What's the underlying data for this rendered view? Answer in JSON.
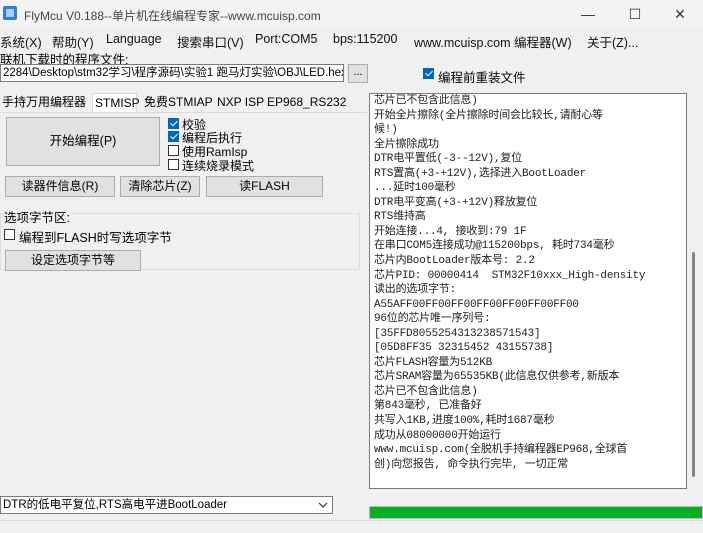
{
  "window": {
    "title": "FlyMcu V0.188--单片机在线编程专家--www.mcuisp.com",
    "minimize": "—",
    "maximize": "☐",
    "close": "✕"
  },
  "menu": [
    "系统(X)",
    "帮助(Y)",
    "Language",
    "搜索串口(V)",
    "Port:COM5",
    "bps:115200",
    "www.mcuisp.com 编程器(W)",
    "关于(Z)..."
  ],
  "file": {
    "label": "联机下载时的程序文件:",
    "path": "2284\\Desktop\\stm32学习\\程序源码\\实验1 跑马灯实验\\OBJ\\LED.hex",
    "browse": "...",
    "reload_label": "编程前重装文件",
    "reload_checked": true
  },
  "tabs": [
    "手持万用编程器",
    "STMISP",
    "免费STMIAP",
    "NXP ISP",
    "EP968_RS232"
  ],
  "active_tab": "STMISP",
  "stmisp": {
    "start_button": "开始编程(P)",
    "options": [
      {
        "label": "校验",
        "checked": true
      },
      {
        "label": "编程后执行",
        "checked": true
      },
      {
        "label": "使用RamIsp",
        "checked": false
      },
      {
        "label": "连续烧录模式",
        "checked": false
      }
    ],
    "read_info_button": "读器件信息(R)",
    "clear_chip_button": "清除芯片(Z)",
    "read_flash_button": "读FLASH",
    "option_group_title": "选项字节区:",
    "write_option_label": "编程到FLASH时写选项字节",
    "write_option_checked": false,
    "set_option_button": "设定选项字节等"
  },
  "log": [
    "芯片已不包含此信息)",
    "开始全片擦除(全片擦除时间会比较长,请耐心等",
    "候!)",
    "全片擦除成功",
    "DTR电平置低(-3--12V),复位",
    "RTS置高(+3-+12V),选择进入BootLoader",
    "...延时100毫秒",
    "DTR电平变高(+3-+12V)释放复位",
    "RTS维持高",
    "开始连接...4, 接收到:79 1F",
    "在串口COM5连接成功@115200bps, 耗时734毫秒",
    "芯片内BootLoader版本号: 2.2",
    "芯片PID: 00000414  STM32F10xxx_High-density",
    "读出的选项字节:",
    "A55AFF00FF00FF00FF00FF00FF00FF00",
    "96位的芯片唯一序列号:",
    "[35FFD8055254313238571543]",
    "[05D8FF35 32315452 43155738]",
    "芯片FLASH容量为512KB",
    "芯片SRAM容量为65535KB(此信息仅供参考,新版本",
    "芯片已不包含此信息)",
    "第843毫秒, 已准备好",
    "共写入1KB,进度100%,耗时1687毫秒",
    "成功从08000000开始运行",
    "www.mcuisp.com(全脱机手持编程器EP968,全球首",
    "创)向您报告, 命令执行完毕, 一切正常"
  ],
  "reset_mode": "DTR的低电平复位,RTS高电平进BootLoader",
  "reset_dropdown_icon": "chevron-down-icon",
  "progress_percent": 100,
  "colors": {
    "progress": "#06b025",
    "checkbox_checked": "#0067c0"
  }
}
